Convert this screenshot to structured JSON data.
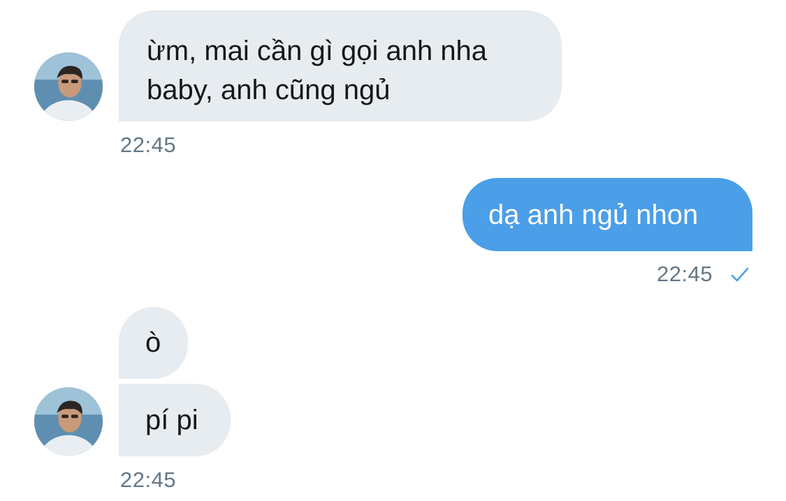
{
  "messages": [
    {
      "direction": "incoming",
      "lines": [
        "ừm, mai cần gì gọi anh nha",
        "baby, anh cũng ngủ"
      ],
      "time": "22:45"
    },
    {
      "direction": "outgoing",
      "lines": [
        "dạ anh ngủ nhon"
      ],
      "time": "22:45",
      "status_icon": "checkmark-icon"
    },
    {
      "direction": "incoming",
      "lines": [
        "ò"
      ]
    },
    {
      "direction": "incoming",
      "lines": [
        "pí pi"
      ],
      "time": "22:45"
    }
  ],
  "colors": {
    "incoming_bubble": "#e6ecf0",
    "outgoing_bubble": "#4b9ee8",
    "timestamp": "#657786",
    "checkmark": "#4b9ee8"
  }
}
